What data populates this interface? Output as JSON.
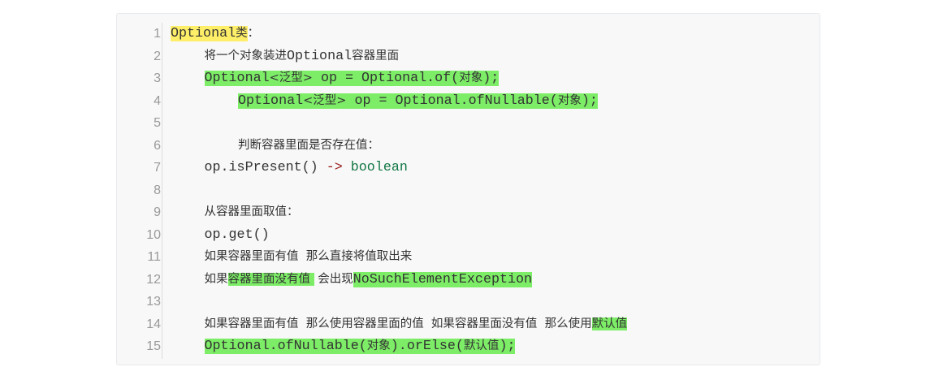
{
  "line_numbers": [
    "1",
    "2",
    "3",
    "4",
    "5",
    "6",
    "7",
    "8",
    "9",
    "10",
    "11",
    "12",
    "13",
    "14",
    "15"
  ],
  "lines": {
    "l1": {
      "a": "Optional",
      "b": "类",
      "c": "："
    },
    "l2": {
      "a": "将一个对象装进",
      "b": "Optional",
      "c": "容器里面"
    },
    "l3": {
      "a": "Optional",
      "b": "<泛型>",
      "c": " op = Optional.of(",
      "d": "对象",
      "e": ");"
    },
    "l4": {
      "a": "Optional",
      "b": "<泛型>",
      "c": " op = Optional.ofNullable(",
      "d": "对象",
      "e": ");"
    },
    "l6": {
      "a": "判断容器里面是否存在值："
    },
    "l7": {
      "a": "op.isPresent() ",
      "b": "->",
      "c": " ",
      "d": "boolean"
    },
    "l9": {
      "a": "从容器里面取值："
    },
    "l10": {
      "a": "op.get()"
    },
    "l11": {
      "a": "如果容器里面有值  那么直接将值取出来"
    },
    "l12": {
      "a": "如果",
      "b": "容器里面没有值 ",
      "c": " 会出现",
      "d": "NoSuchElementException"
    },
    "l14": {
      "a": "如果容器里面有值  那么使用容器里面的值  如果容器里面没有值  那么使用",
      "b": "默认值"
    },
    "l15": {
      "a": "Optional.ofNullable(",
      "b": "对象",
      "c": ").orElse(",
      "d": "默认值",
      "e": ");"
    }
  },
  "colors": {
    "highlight_yellow": "#ffef68",
    "highlight_green": "#7ded67",
    "operator_red": "#981a1a",
    "keyword_green": "#117744",
    "line_number_gray": "#999999"
  }
}
